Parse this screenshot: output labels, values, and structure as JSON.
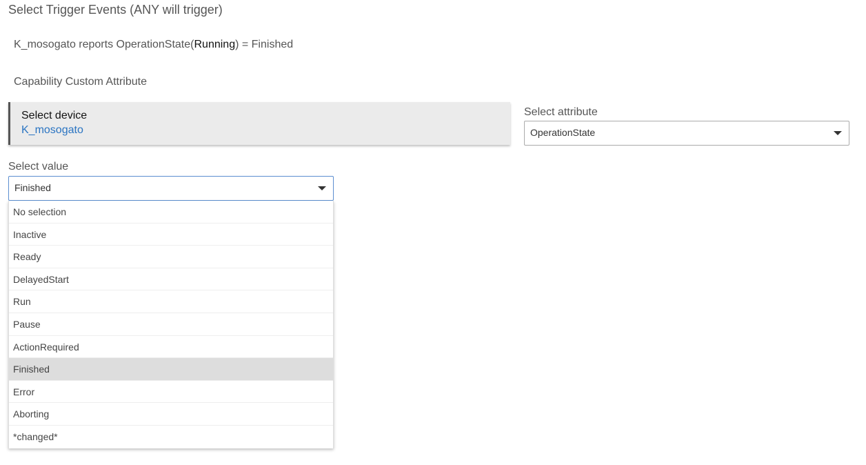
{
  "page": {
    "title": "Select Trigger Events (ANY will trigger)"
  },
  "trigger": {
    "prefix": "K_mosogato reports OperationState(",
    "highlight": "Running",
    "suffix": ") = Finished"
  },
  "capability": {
    "label": "Capability Custom Attribute"
  },
  "device": {
    "label": "Select device",
    "value": "K_mosogato"
  },
  "attribute": {
    "label": "Select attribute",
    "value": "OperationState",
    "icon": "chevron-down-icon"
  },
  "value_select": {
    "label": "Select value",
    "value": "Finished",
    "icon": "chevron-down-icon",
    "options": [
      {
        "label": "No selection",
        "selected": false
      },
      {
        "label": "Inactive",
        "selected": false
      },
      {
        "label": "Ready",
        "selected": false
      },
      {
        "label": "DelayedStart",
        "selected": false
      },
      {
        "label": "Run",
        "selected": false
      },
      {
        "label": "Pause",
        "selected": false
      },
      {
        "label": "ActionRequired",
        "selected": false
      },
      {
        "label": "Finished",
        "selected": true
      },
      {
        "label": "Error",
        "selected": false
      },
      {
        "label": "Aborting",
        "selected": false
      },
      {
        "label": "*changed*",
        "selected": false
      }
    ]
  },
  "colors": {
    "link": "#2a74c2",
    "selected_bg": "#dddddd",
    "card_bg": "#ebebeb"
  }
}
